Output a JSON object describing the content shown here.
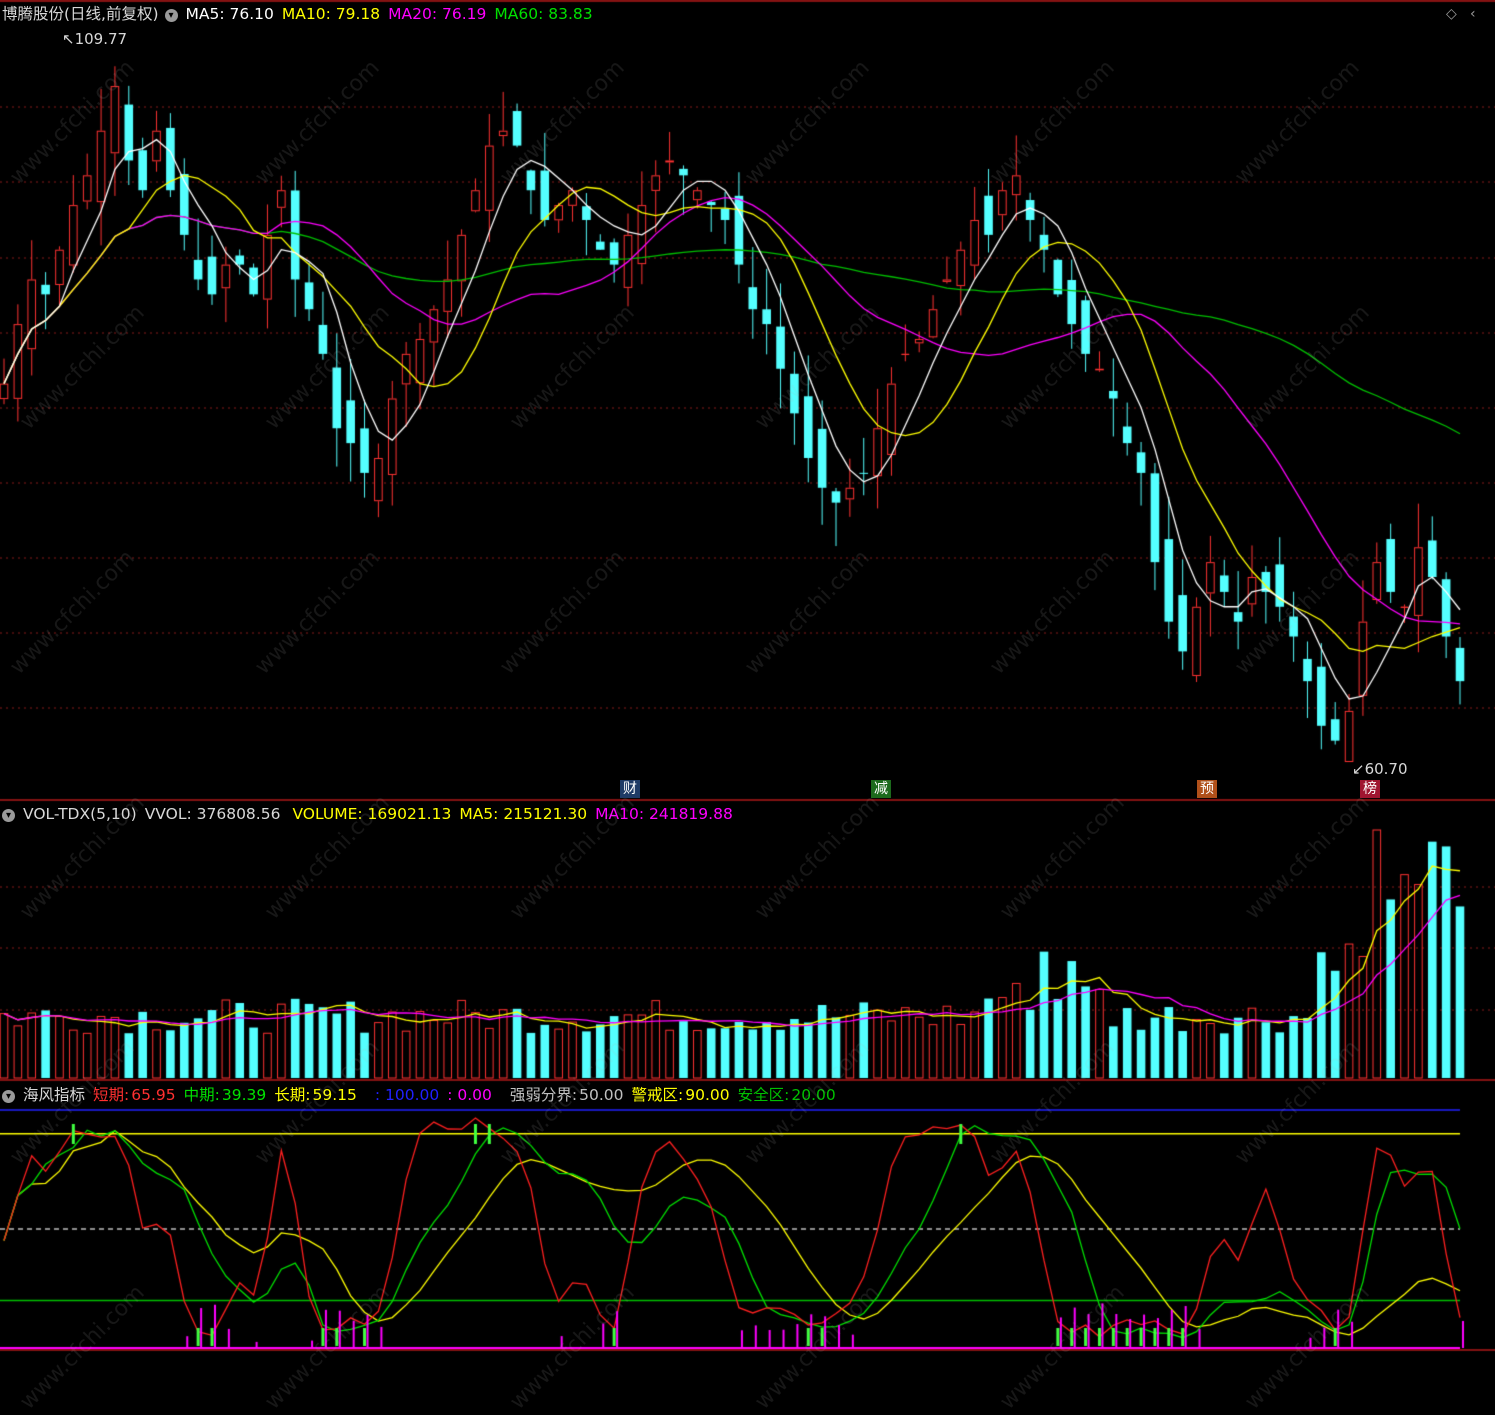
{
  "colors": {
    "up": "#ff3232",
    "down": "#54ffff",
    "ma5": "#ffffff",
    "ma10": "#ffff00",
    "ma20": "#ff00ff",
    "ma60": "#00c000",
    "grid": "#8b1a1a",
    "border": "#b01818"
  },
  "price_panel": {
    "title": "博腾股份(日线,前复权)",
    "ma_labels": [
      "MA5: 76.10",
      "MA10: 79.18",
      "MA20: 76.19",
      "MA60: 83.83"
    ],
    "high_marker": "109.77",
    "low_marker": "60.70",
    "events": [
      {
        "label": "财",
        "bg": "#1f3b66"
      },
      {
        "label": "减",
        "bg": "#1c6a1c"
      },
      {
        "label": "预",
        "bg": "#b0501a"
      },
      {
        "label": "榜",
        "bg": "#a01530"
      }
    ]
  },
  "volume_panel": {
    "name": "VOL-TDX(5,10)",
    "vvol": "VVOL: 376808.56",
    "volume": "VOLUME: 169021.13",
    "ma5": "MA5: 215121.30",
    "ma10": "MA10: 241819.88"
  },
  "indicator_panel": {
    "name": "海风指标",
    "short_label": "短期:",
    "short_value": "65.95",
    "mid_label": "中期:",
    "mid_value": "39.39",
    "long_label": "长期:",
    "long_value": "59.15",
    "extra1": ": 100.00",
    "extra2": ": 0.00",
    "boundary_label": "强弱分界:",
    "boundary_value": "50.00",
    "warn_label": "警戒区:",
    "warn_value": "90.00",
    "safe_label": "安全区:",
    "safe_value": "20.00"
  },
  "chart_data": {
    "type": "candlestick",
    "symbol": "博腾股份",
    "period": "日线",
    "visible_high": 109.77,
    "visible_low": 60.7,
    "closes": [
      86,
      90,
      93,
      92,
      95,
      98,
      100,
      103,
      106,
      101,
      99,
      103,
      99,
      96,
      93,
      92,
      94,
      94,
      92,
      96,
      99,
      93,
      91,
      88,
      83,
      82,
      80,
      81,
      85,
      88,
      89,
      91,
      93,
      96,
      99,
      102,
      103,
      102,
      99,
      97,
      98,
      99,
      97,
      95,
      94,
      96,
      98,
      100,
      101,
      100,
      99,
      98,
      97,
      94,
      91,
      90,
      87,
      84,
      81,
      79,
      78,
      79,
      80,
      83,
      86,
      88,
      89,
      91,
      93,
      95,
      97,
      96,
      99,
      100,
      97,
      95,
      92,
      90,
      88,
      87,
      85,
      82,
      80,
      74,
      70,
      68,
      71,
      74,
      72,
      70,
      73,
      72,
      71,
      69,
      66,
      63,
      62,
      64,
      70,
      74,
      72,
      71,
      75,
      73,
      69,
      66
    ]
  }
}
